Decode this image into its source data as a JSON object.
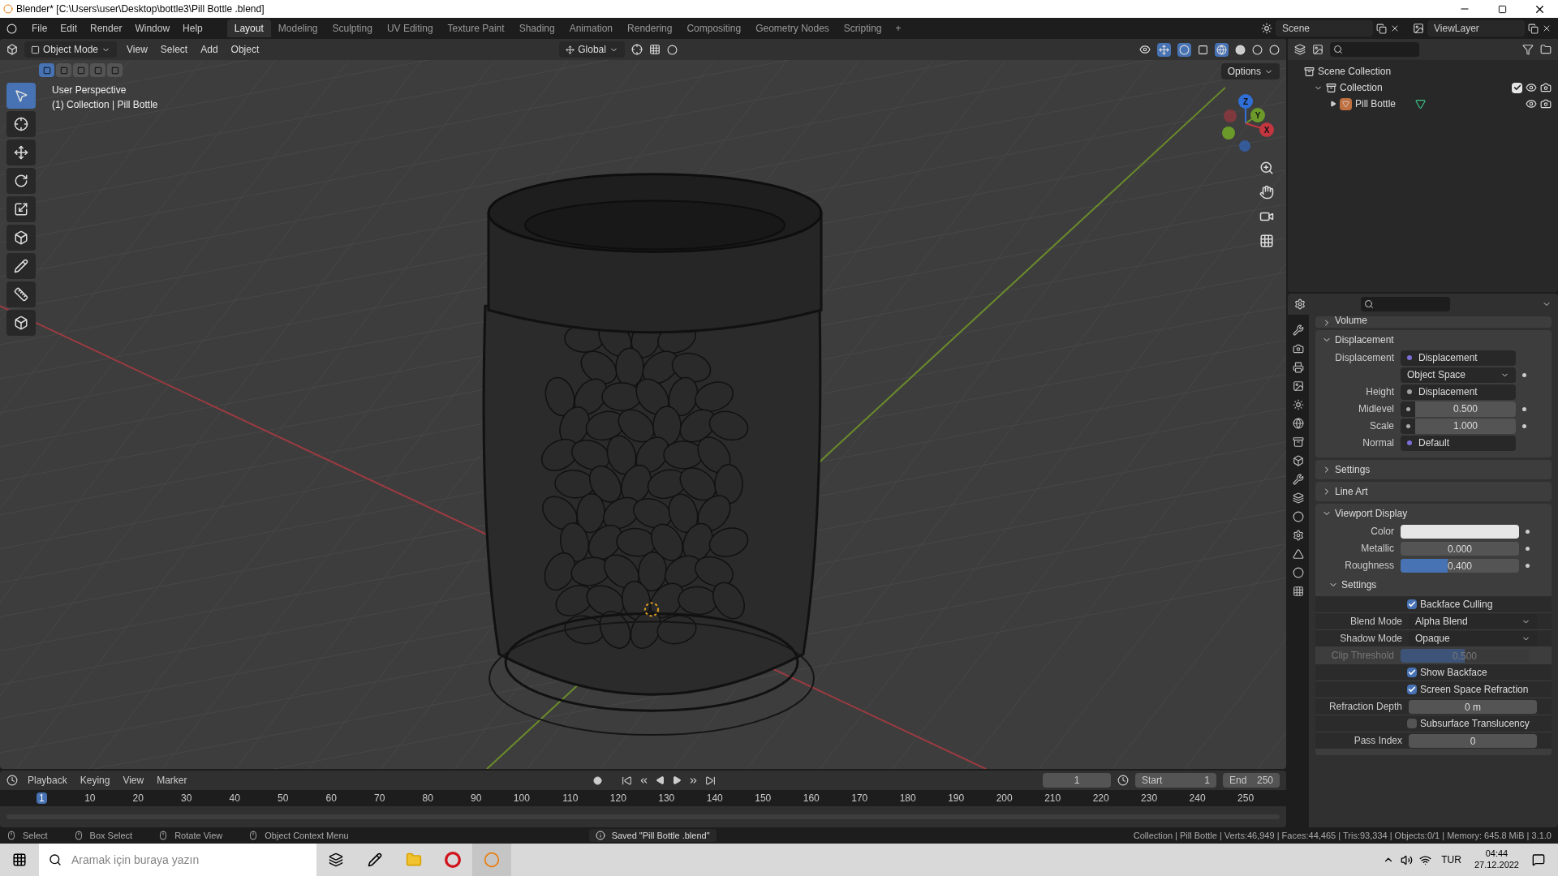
{
  "window": {
    "title": "Blender* [C:\\Users\\user\\Desktop\\bottle3\\Pill Bottle .blend]"
  },
  "menu": [
    "File",
    "Edit",
    "Render",
    "Window",
    "Help"
  ],
  "workspaces": [
    {
      "label": "Layout",
      "selected": true
    },
    {
      "label": "Modeling",
      "selected": false
    },
    {
      "label": "Sculpting",
      "selected": false
    },
    {
      "label": "UV Editing",
      "selected": false
    },
    {
      "label": "Texture Paint",
      "selected": false
    },
    {
      "label": "Shading",
      "selected": false
    },
    {
      "label": "Animation",
      "selected": false
    },
    {
      "label": "Rendering",
      "selected": false
    },
    {
      "label": "Compositing",
      "selected": false
    },
    {
      "label": "Geometry Nodes",
      "selected": false
    },
    {
      "label": "Scripting",
      "selected": false
    }
  ],
  "add_workspace": "+",
  "scene": "Scene",
  "view_layer": "ViewLayer",
  "viewport": {
    "mode": "Object Mode",
    "menus": [
      "View",
      "Select",
      "Add",
      "Object"
    ],
    "orientation": "Global",
    "options": "Options",
    "info": [
      "User Perspective",
      "(1) Collection | Pill Bottle"
    ],
    "axes": [
      "Z",
      "Y",
      "X"
    ]
  },
  "outliner": {
    "items": [
      {
        "label": "Scene Collection",
        "children": [
          {
            "label": "Collection",
            "checked": true,
            "children": [
              {
                "label": "Pill Bottle",
                "expanded": false
              }
            ]
          }
        ]
      }
    ]
  },
  "properties": {
    "sections": [
      {
        "title": "Volume",
        "expanded": false
      },
      {
        "title": "Displacement",
        "expanded": true,
        "rows": [
          {
            "kind": "socket",
            "label": "Displacement",
            "value": "Displacement",
            "color": "#7b6fd6"
          },
          {
            "kind": "dropdown",
            "value": "Object Space"
          },
          {
            "kind": "socket",
            "label": "Height",
            "value": "Displacement",
            "color": "#a1a1a1"
          },
          {
            "kind": "number",
            "label": "Midlevel",
            "value": "0.500"
          },
          {
            "kind": "number",
            "label": "Scale",
            "value": "1.000"
          },
          {
            "kind": "socket",
            "label": "Normal",
            "value": "Default",
            "color": "#7b6fd6"
          }
        ]
      },
      {
        "title": "Settings",
        "expanded": false
      },
      {
        "title": "Line Art",
        "expanded": false
      },
      {
        "title": "Viewport Display",
        "expanded": true,
        "rows": [
          {
            "kind": "color",
            "label": "Color",
            "color": "#e6e6e6"
          },
          {
            "kind": "slider",
            "label": "Metallic",
            "value": "0.000",
            "level": 0
          },
          {
            "kind": "slider",
            "label": "Roughness",
            "value": "0.400",
            "level": 0.4
          },
          {
            "kind": "subsection",
            "label": "Settings",
            "expanded": true
          },
          {
            "kind": "checkbox",
            "label": "Backface Culling",
            "checked": true
          },
          {
            "kind": "select",
            "label": "Blend Mode",
            "value": "Alpha Blend"
          },
          {
            "kind": "select",
            "label": "Shadow Mode",
            "value": "Opaque"
          },
          {
            "kind": "slider",
            "label": "Clip Threshold",
            "value": "0.500",
            "level": 0.5,
            "disabled": true
          },
          {
            "kind": "checkbox",
            "label": "Show Backface",
            "checked": true
          },
          {
            "kind": "checkbox",
            "label": "Screen Space Refraction",
            "checked": true
          },
          {
            "kind": "field",
            "label": "Refraction Depth",
            "value": "0 m"
          },
          {
            "kind": "checkbox",
            "label": "Subsurface Translucency",
            "checked": false
          },
          {
            "kind": "field",
            "label": "Pass Index",
            "value": "0"
          }
        ]
      }
    ]
  },
  "timeline": {
    "menus": [
      "Playback",
      "Keying",
      "View",
      "Marker"
    ],
    "current_frame": "1",
    "start_label": "Start",
    "start": "1",
    "end_label": "End",
    "end": "250",
    "ticks": [
      "1",
      "10",
      "20",
      "30",
      "40",
      "50",
      "60",
      "70",
      "80",
      "90",
      "100",
      "110",
      "120",
      "130",
      "140",
      "150",
      "160",
      "170",
      "180",
      "190",
      "200",
      "210",
      "220",
      "230",
      "240",
      "250"
    ]
  },
  "status_bar": {
    "hints": [
      "Select",
      "Box Select",
      "Rotate View",
      "Object Context Menu"
    ],
    "message": "Saved \"Pill Bottle .blend\"",
    "stats": "Collection | Pill Bottle | Verts:46,949 | Faces:44,465 | Tris:93,334 | Objects:0/1 | Memory: 645.8 MiB | 3.1.0"
  },
  "taskbar": {
    "search_placeholder": "Aramak için buraya yazın",
    "language": "TUR",
    "time": "04:44",
    "date": "27.12.2022"
  }
}
